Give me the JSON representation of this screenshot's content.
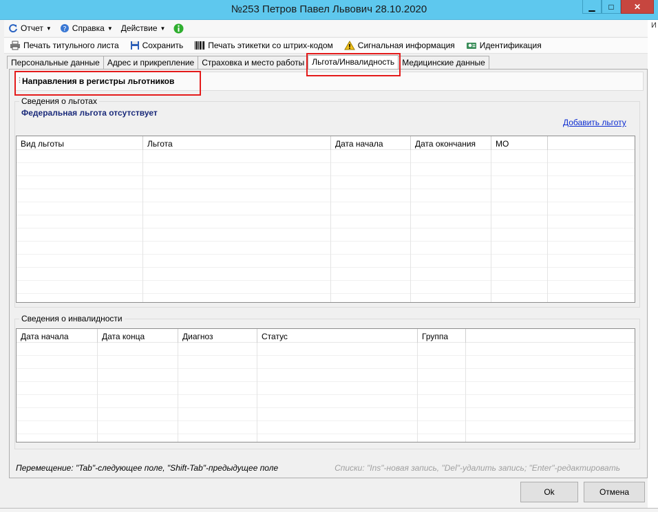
{
  "window": {
    "title": "№253 Петров Павел Львович 28.10.2020",
    "controls": {
      "minimize": "▁",
      "maximize": "□",
      "close": "✕"
    }
  },
  "side_text": "И",
  "menubar": {
    "items": [
      {
        "label": "Отчет",
        "icon": "refresh-icon"
      },
      {
        "label": "Справка",
        "icon": "help-icon"
      },
      {
        "label": "Действие",
        "icon": ""
      }
    ],
    "info_icon": "info-icon"
  },
  "toolbar": {
    "items": [
      {
        "label": "Печать титульного листа",
        "icon": "print-icon"
      },
      {
        "label": "Сохранить",
        "icon": "save-icon"
      },
      {
        "label": "Печать этикетки со штрих-кодом",
        "icon": "barcode-icon"
      },
      {
        "label": "Сигнальная информация",
        "icon": "warning-icon"
      },
      {
        "label": "Идентификация",
        "icon": "identify-icon"
      }
    ]
  },
  "tabs": [
    {
      "label": "Персональные данные"
    },
    {
      "label": "Адрес и прикрепление"
    },
    {
      "label": "Страховка и место работы"
    },
    {
      "label": "Льгота/Инвалидность",
      "active": true
    },
    {
      "label": "Медицинские данные"
    }
  ],
  "subbar": {
    "label": "Направления в регистры льготников"
  },
  "benefits": {
    "legend": "Сведения о льготах",
    "federal_status": "Федеральная льгота отсутствует",
    "add_link": "Добавить льготу",
    "columns": [
      "Вид льготы",
      "Льгота",
      "Дата начала",
      "Дата окончания",
      "МО"
    ],
    "rows": []
  },
  "disability": {
    "legend": "Сведения о инвалидности",
    "columns": [
      "Дата начала",
      "Дата конца",
      "Диагноз",
      "Статус",
      "Группа"
    ],
    "rows": []
  },
  "hints": {
    "left": "Перемещение: \"Tab\"-следующее поле, \"Shift-Tab\"-предыдущее поле",
    "right": "Списки: \"Ins\"-новая запись, \"Del\"-удалить запись; \"Enter\"-редактировать"
  },
  "buttons": {
    "ok": "Ok",
    "cancel": "Отмена"
  },
  "colors": {
    "titlebar": "#5ec8ee",
    "highlight": "#e41a1a",
    "link": "#0b2bd1",
    "federal": "#1a2a7a"
  }
}
